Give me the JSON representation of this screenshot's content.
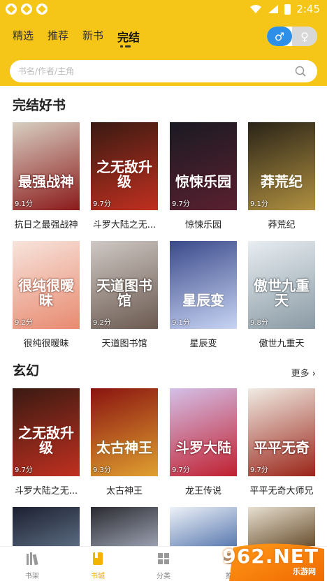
{
  "status_bar": {
    "time": "2:45"
  },
  "tabs": [
    "精选",
    "推荐",
    "新书",
    "完结"
  ],
  "gender": {
    "male": "♂",
    "female": "♀"
  },
  "search": {
    "placeholder": "书名/作者/主角"
  },
  "sections": [
    {
      "title": "完结好书",
      "books": [
        {
          "title": "抗日之最强战神",
          "score": "9.1分",
          "cover_text": "最强战神",
          "colors": [
            "#d8cfc2",
            "#8a1a1a"
          ]
        },
        {
          "title": "斗罗大陆之无...",
          "score": "9.7分",
          "cover_text": "之无敌升级",
          "colors": [
            "#3a1a12",
            "#c03020"
          ]
        },
        {
          "title": "惊悚乐园",
          "score": "9.7分",
          "cover_text": "惊悚乐园",
          "colors": [
            "#1a1a22",
            "#5a2030"
          ]
        },
        {
          "title": "莽荒纪",
          "score": "9.1分",
          "cover_text": "莽荒纪",
          "colors": [
            "#2a2418",
            "#b09040"
          ]
        },
        {
          "title": "很纯很暧昧",
          "score": "9.2分",
          "cover_text": "很纯很暧昧",
          "colors": [
            "#f7e4dc",
            "#e88a70"
          ]
        },
        {
          "title": "天道图书馆",
          "score": "9.2分",
          "cover_text": "天道图书馆",
          "colors": [
            "#cfc8c4",
            "#6b5a50"
          ]
        },
        {
          "title": "星辰变",
          "score": "9.1分",
          "cover_text": "星辰变",
          "colors": [
            "#3a4a8a",
            "#c8d4f4"
          ]
        },
        {
          "title": "傲世九重天",
          "score": "9.8分",
          "cover_text": "傲世九重天",
          "colors": [
            "#e8eef2",
            "#8a9aa4"
          ]
        }
      ]
    },
    {
      "title": "玄幻",
      "more": "更多 ›",
      "books": [
        {
          "title": "斗罗大陆之无...",
          "score": "9.7分",
          "cover_text": "之无敌升级",
          "colors": [
            "#3a1a12",
            "#c03020"
          ]
        },
        {
          "title": "太古神王",
          "score": "9.3分",
          "cover_text": "太古神王",
          "colors": [
            "#8a1410",
            "#e0a030"
          ]
        },
        {
          "title": "龙王传说",
          "score": "9.7分",
          "cover_text": "斗罗大陆",
          "colors": [
            "#d4c0e8",
            "#c02030"
          ]
        },
        {
          "title": "平平无奇大师兄",
          "score": "9.7分",
          "cover_text": "平平无奇",
          "colors": [
            "#f0ece4",
            "#9a2418"
          ]
        }
      ]
    }
  ],
  "partial_covers": [
    {
      "colors": [
        "#1c2030",
        "#5a6a80"
      ]
    },
    {
      "colors": [
        "#2a2a30",
        "#9aa0b0"
      ]
    },
    {
      "colors": [
        "#eef2f8",
        "#5a7ab0"
      ]
    },
    {
      "colors": [
        "#e8e0d0",
        "#6a5030"
      ]
    }
  ],
  "bottom_nav": [
    {
      "label": "书架"
    },
    {
      "label": "书城"
    },
    {
      "label": "分类"
    },
    {
      "label": "推"
    }
  ],
  "watermark": {
    "text": "962.NET",
    "sub": "乐游网"
  },
  "colors": {
    "brand": "#f5c518",
    "male": "#2d8fe8",
    "active_nav": "#e6a800"
  }
}
